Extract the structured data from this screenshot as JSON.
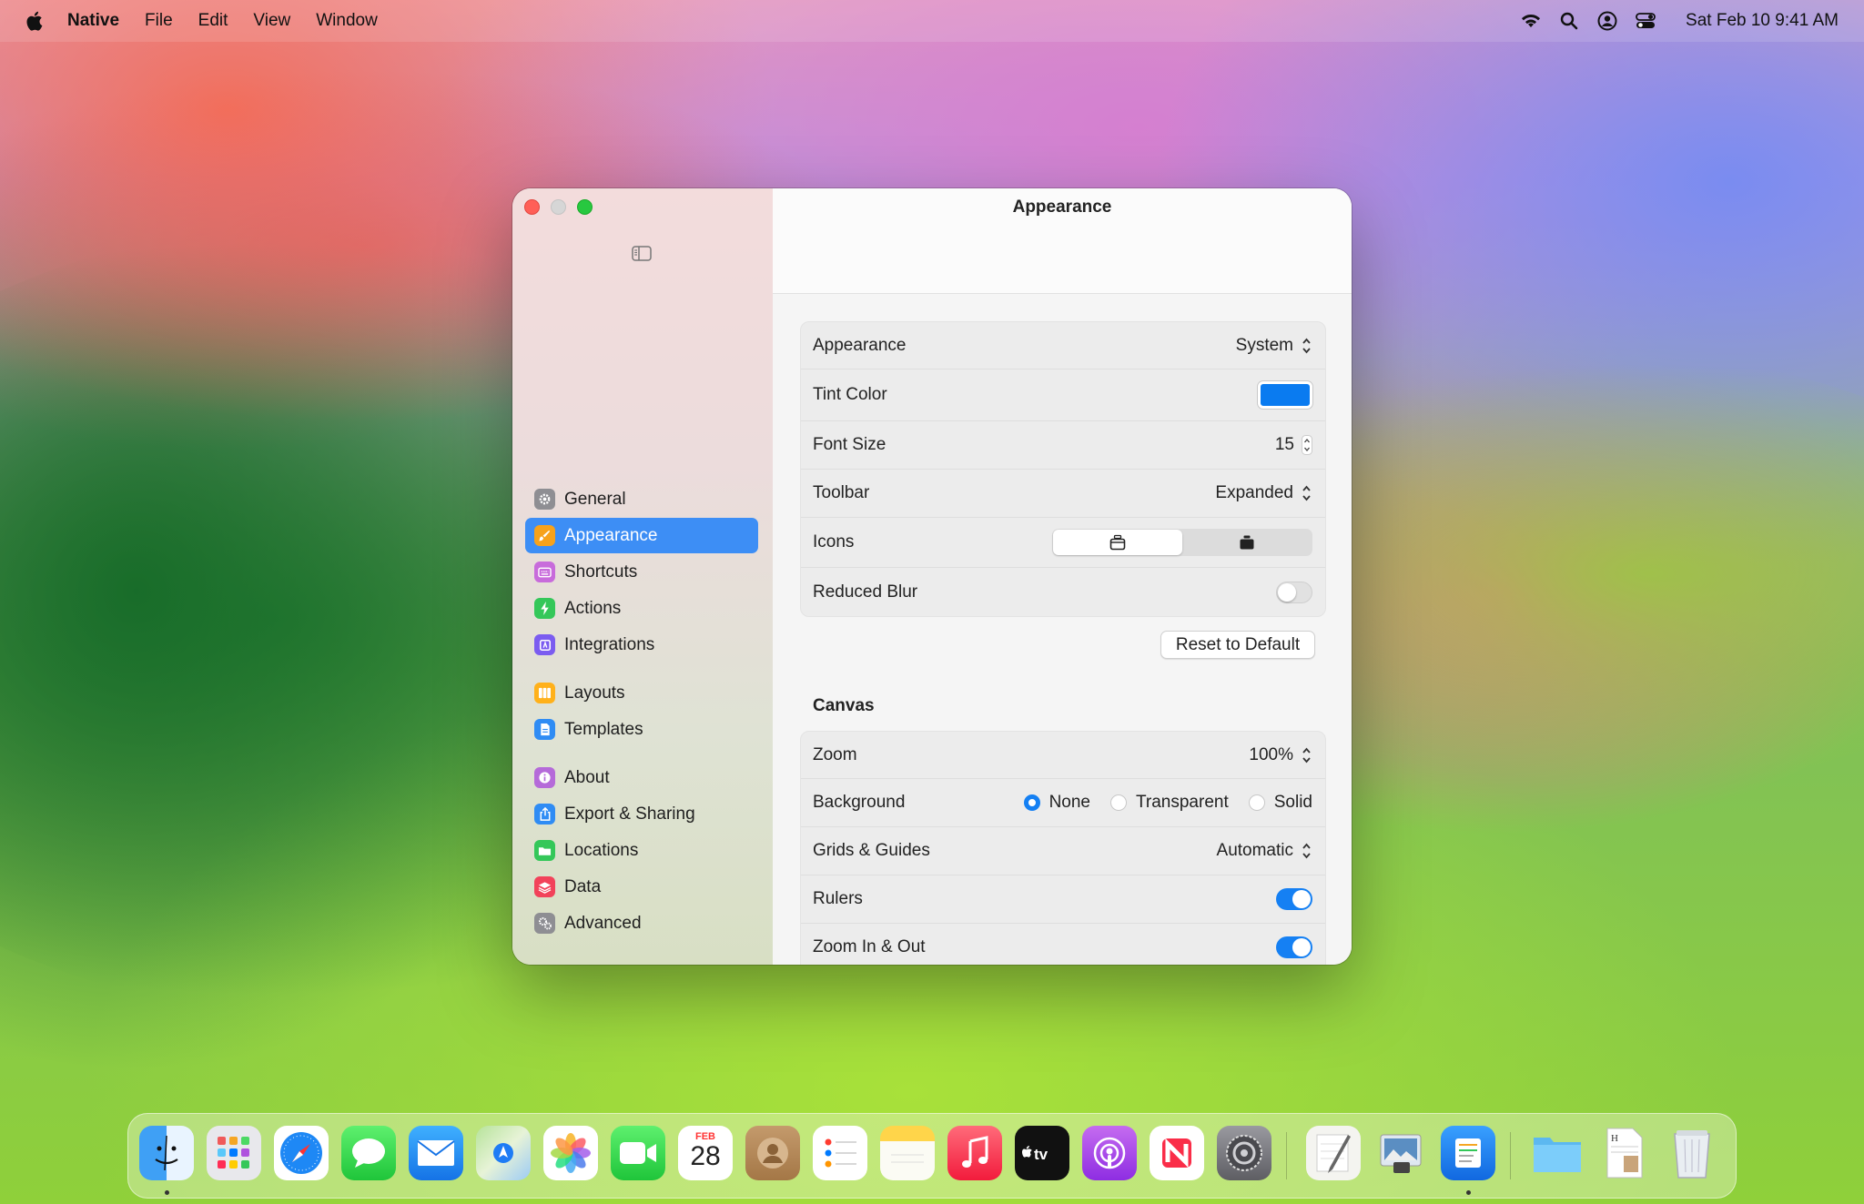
{
  "menubar": {
    "app_name": "Native",
    "items": [
      "File",
      "Edit",
      "View",
      "Window"
    ],
    "clock": "Sat Feb 10 9:41 AM"
  },
  "window": {
    "title": "Appearance"
  },
  "sidebar": {
    "groups": [
      [
        {
          "label": "General",
          "icon": "gear-icon",
          "color": "#8e8e93"
        },
        {
          "label": "Appearance",
          "icon": "paintbrush-icon",
          "color": "#f7a21b",
          "active": true
        },
        {
          "label": "Shortcuts",
          "icon": "keyboard-icon",
          "color": "#c86bdb"
        },
        {
          "label": "Actions",
          "icon": "bolt-icon",
          "color": "#34c759"
        },
        {
          "label": "Integrations",
          "icon": "plugin-icon",
          "color": "#7b5cf0"
        }
      ],
      [
        {
          "label": "Layouts",
          "icon": "columns-icon",
          "color": "#ffb11b"
        },
        {
          "label": "Templates",
          "icon": "document-icon",
          "color": "#2f8cf4"
        }
      ],
      [
        {
          "label": "About",
          "icon": "info-icon",
          "color": "#b56ad9"
        },
        {
          "label": "Export & Sharing",
          "icon": "share-icon",
          "color": "#2f8cf4"
        },
        {
          "label": "Locations",
          "icon": "folder-icon",
          "color": "#34c759"
        },
        {
          "label": "Data",
          "icon": "layers-icon",
          "color": "#f2425a"
        },
        {
          "label": "Advanced",
          "icon": "gears-icon",
          "color": "#8e8e93"
        }
      ]
    ]
  },
  "appearance": {
    "appearance_label": "Appearance",
    "appearance_value": "System",
    "tint_label": "Tint Color",
    "tint_color": "#0a7bf0",
    "font_size_label": "Font Size",
    "font_size_value": "15",
    "toolbar_label": "Toolbar",
    "toolbar_value": "Expanded",
    "icons_label": "Icons",
    "icons_options": [
      "outline-icon",
      "filled-icon"
    ],
    "icons_selected": 0,
    "reduced_blur_label": "Reduced Blur",
    "reduced_blur_on": false,
    "reset_label": "Reset to Default"
  },
  "canvas": {
    "heading": "Canvas",
    "zoom_label": "Zoom",
    "zoom_value": "100%",
    "background_label": "Background",
    "background_options": [
      "None",
      "Transparent",
      "Solid"
    ],
    "background_selected": "None",
    "grids_label": "Grids & Guides",
    "grids_value": "Automatic",
    "rulers_label": "Rulers",
    "rulers_on": true,
    "zoom_inout_label": "Zoom In & Out",
    "zoom_inout_on": true
  },
  "dock": {
    "calendar_month": "FEB",
    "calendar_day": "28",
    "apps": [
      "Finder",
      "Launchpad",
      "Safari",
      "Messages",
      "Mail",
      "Maps",
      "Photos",
      "FaceTime",
      "Calendar",
      "Contacts",
      "Reminders",
      "Notes",
      "Music",
      "TV",
      "Podcasts",
      "News",
      "System Settings",
      "Script Editor",
      "Preview",
      "Native",
      "Folder",
      "TextEdit",
      "Trash"
    ]
  }
}
